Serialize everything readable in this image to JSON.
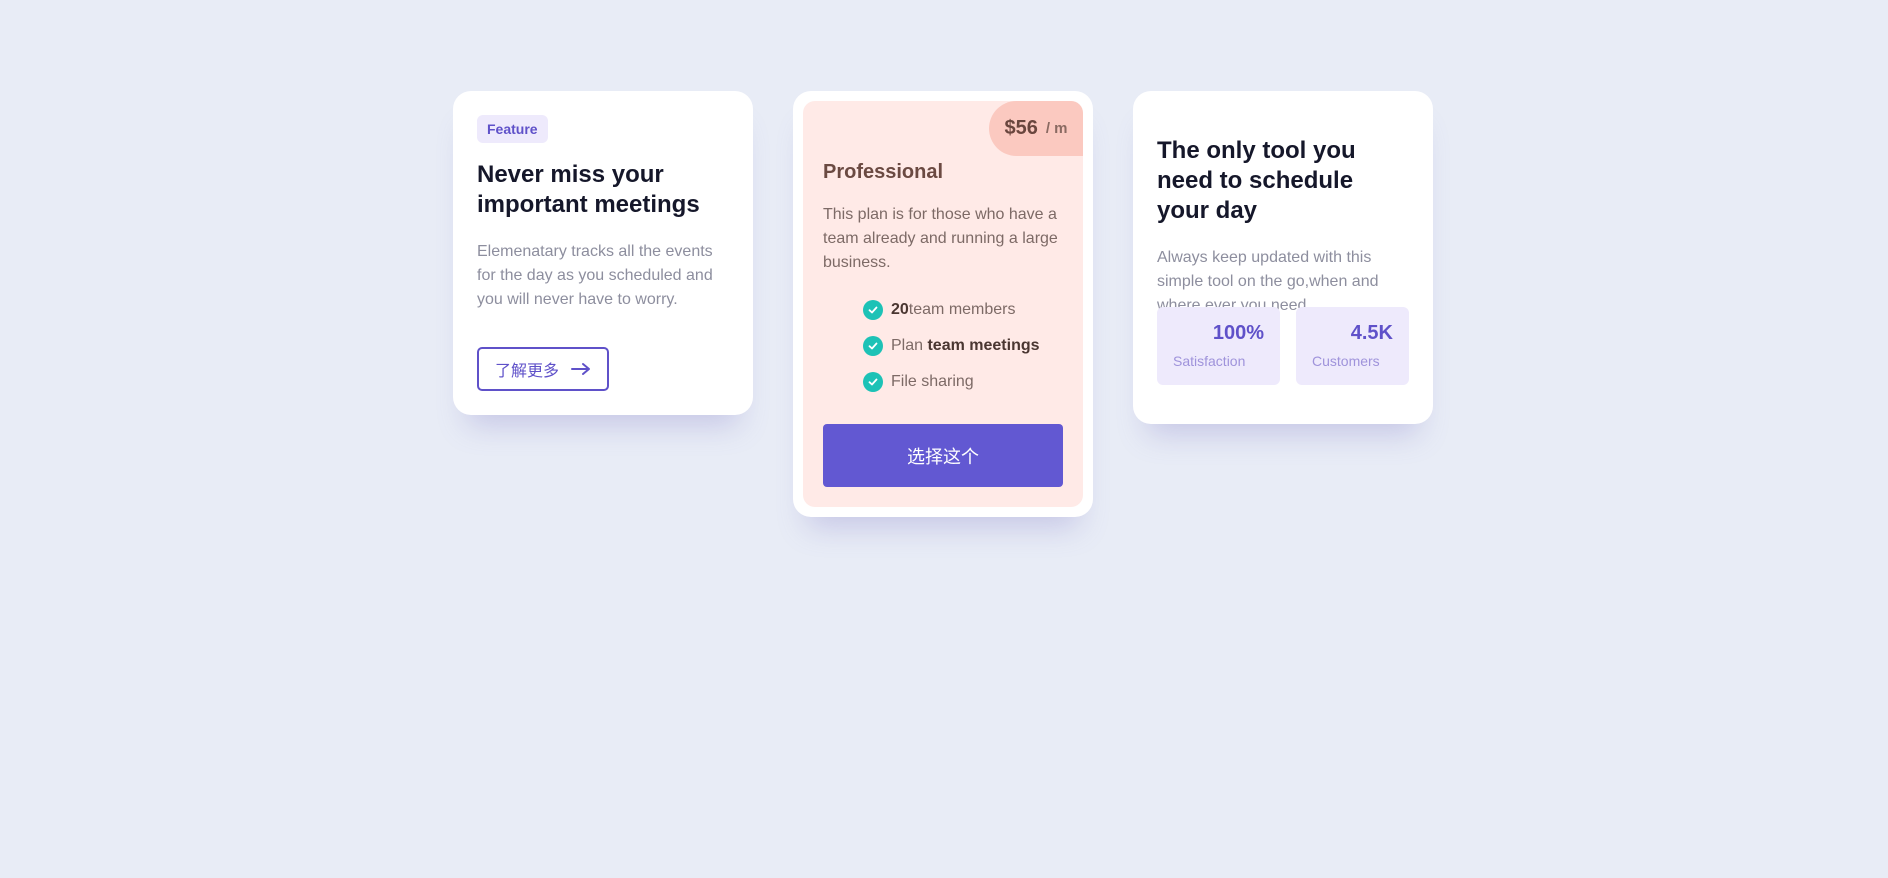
{
  "feature_card": {
    "badge": "Feature",
    "title": "Never miss your important meetings",
    "text": "Elemenatary tracks all the events for the day as you scheduled and you will never have to worry.",
    "button_label": "了解更多",
    "button_icon": "arrow-right-icon"
  },
  "pricing_card": {
    "price": "$56",
    "period": "/ m",
    "plan_name": "Professional",
    "description": "This plan is for those who have a team already and running a large business.",
    "features": [
      {
        "bold": "20",
        "text": "team members"
      },
      {
        "prefix": "Plan ",
        "bold": "team meetings"
      },
      {
        "text": "File sharing"
      }
    ],
    "button_label": "选择这个",
    "check_icon": "check-circle-icon"
  },
  "tool_card": {
    "title": "The only tool you need to schedule your day",
    "text": "Always keep updated with this simple tool on the go,when and where ever you need.",
    "stats": [
      {
        "value": "100%",
        "label": "Satisfaction"
      },
      {
        "value": "4.5K",
        "label": "Customers"
      }
    ]
  },
  "colors": {
    "background": "#e8ecf6",
    "accent": "#6258d2",
    "pricing_bg": "#ffeae7",
    "price_tag_bg": "#fbc9c0",
    "check": "#1dc2b6"
  }
}
